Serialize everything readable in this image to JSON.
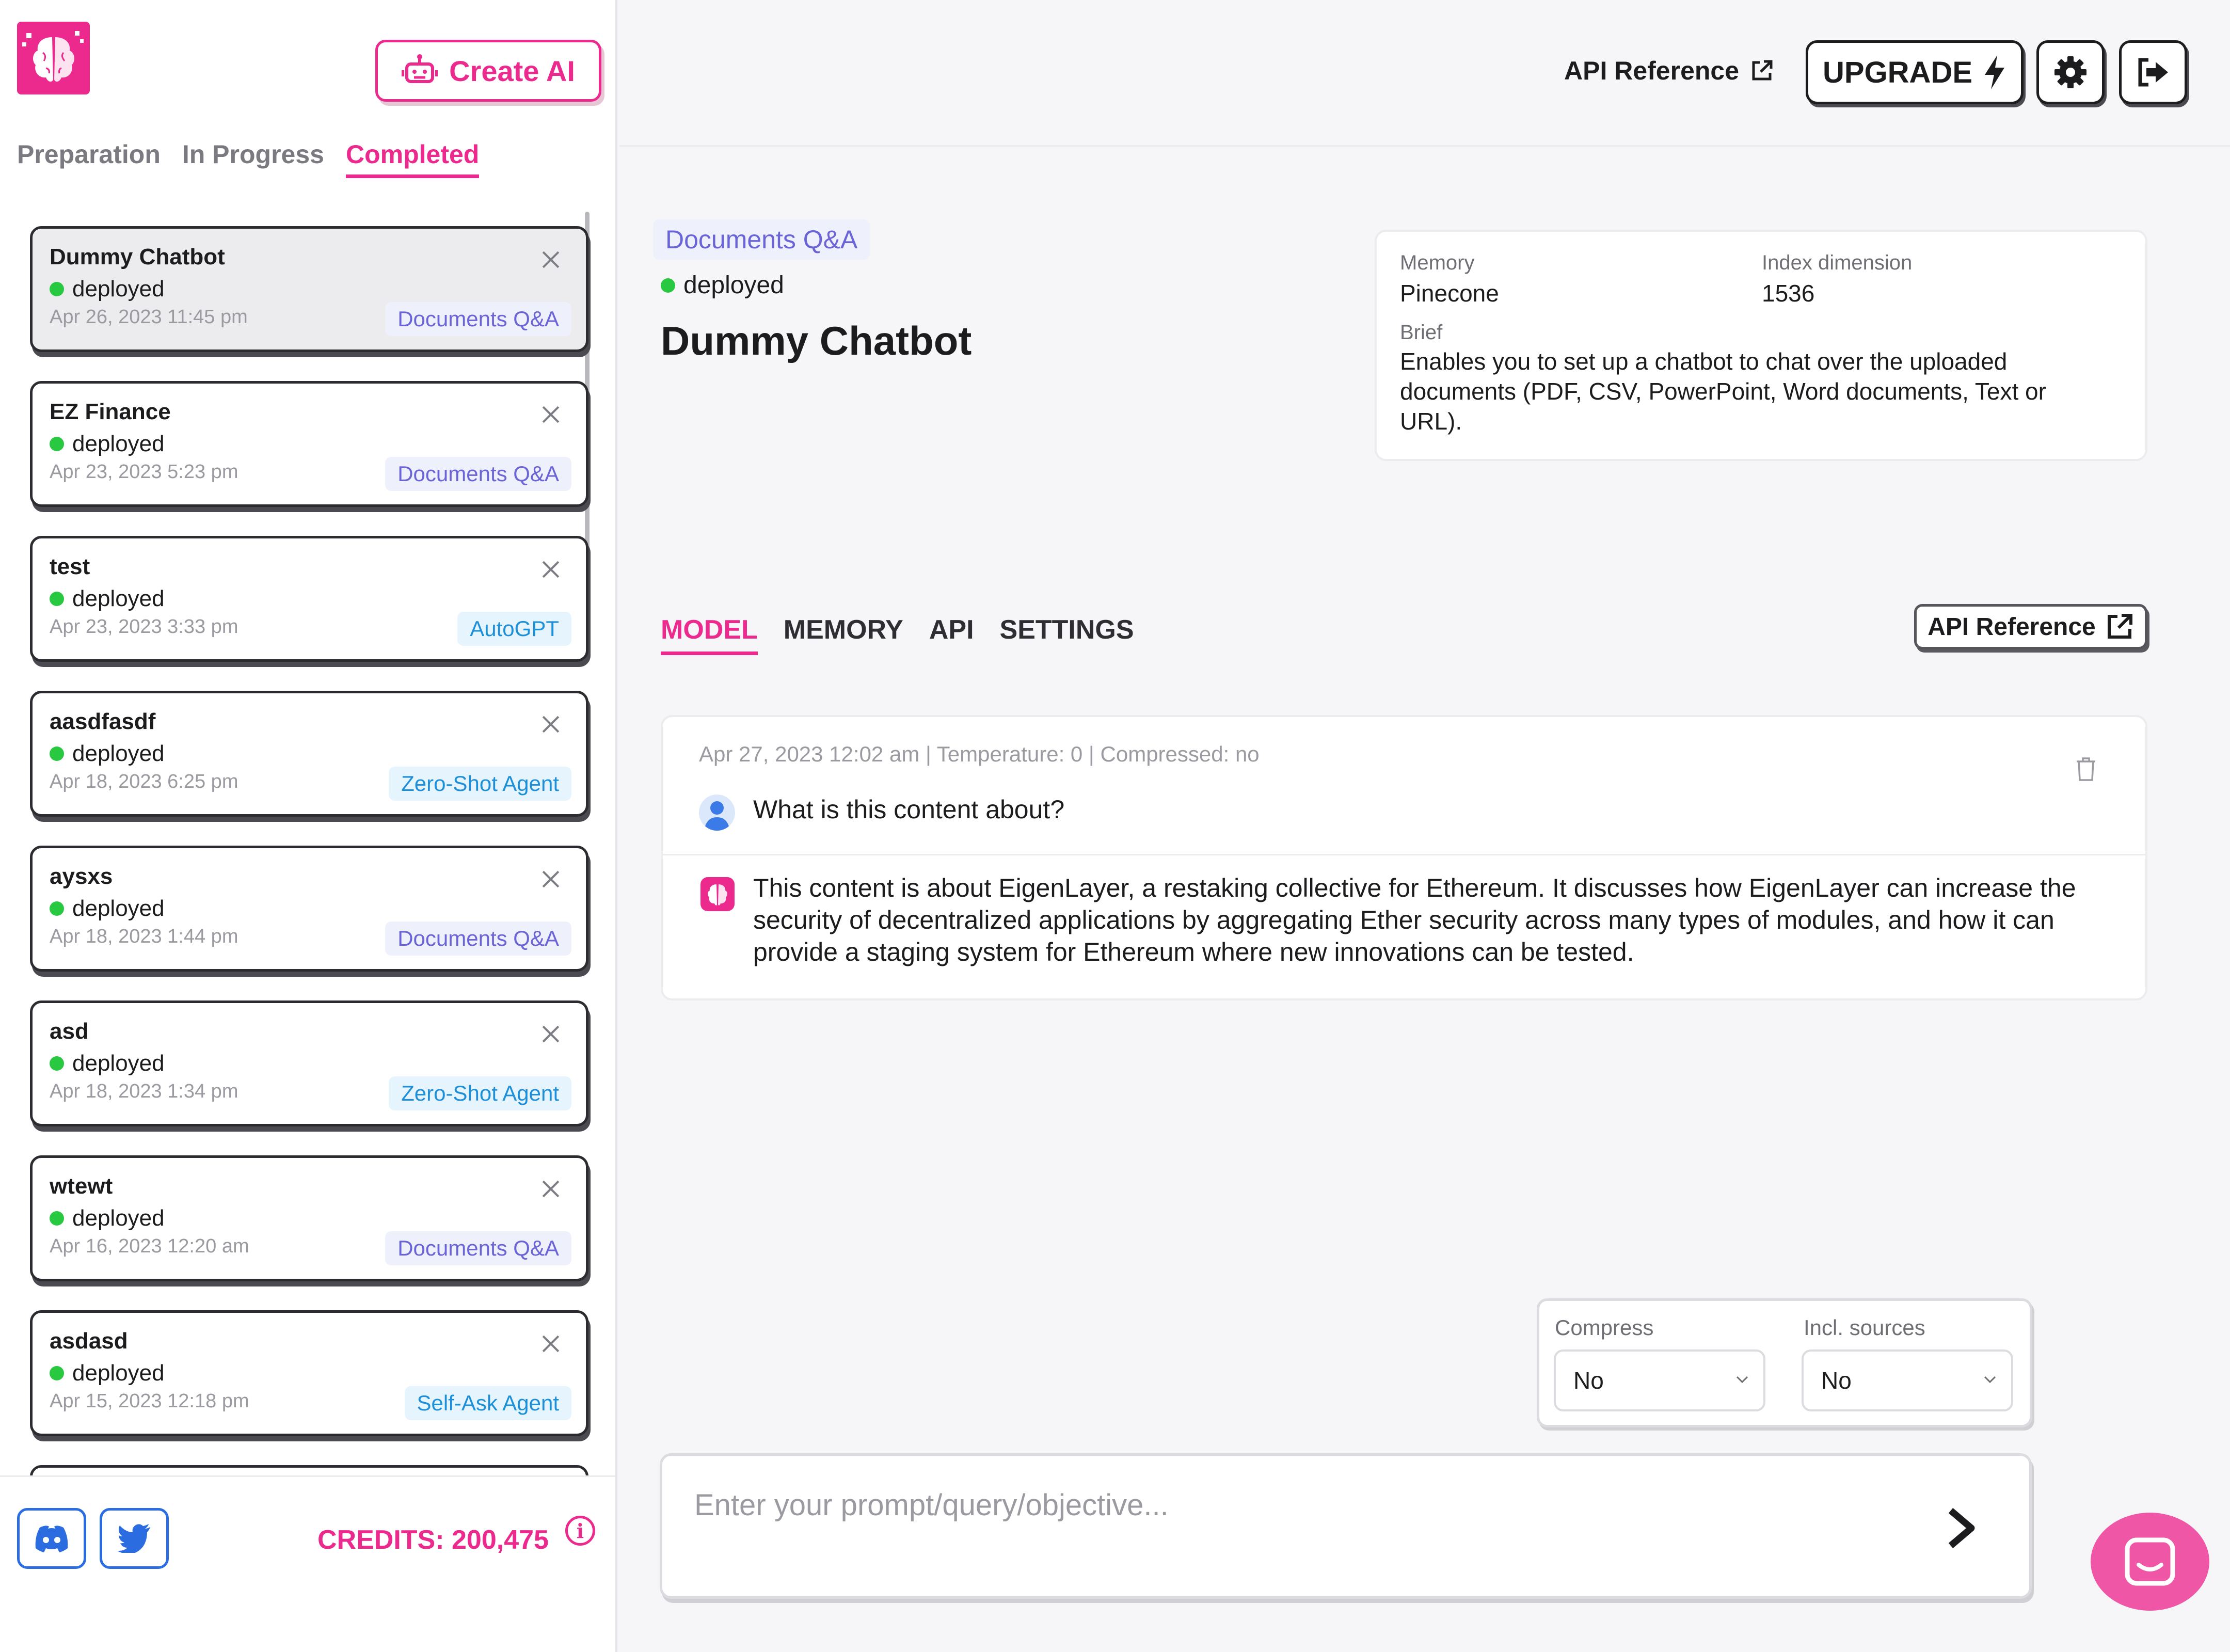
{
  "sidebar": {
    "create_button_label": "Create AI",
    "status_tabs": [
      "Preparation",
      "In Progress",
      "Completed"
    ],
    "projects": [
      {
        "name": "Dummy Chatbot",
        "status": "deployed",
        "date": "Apr 26, 2023 11:45 pm",
        "type": "Documents Q&A",
        "tag_color": "purple"
      },
      {
        "name": "EZ Finance",
        "status": "deployed",
        "date": "Apr 23, 2023 5:23 pm",
        "type": "Documents Q&A",
        "tag_color": "purple"
      },
      {
        "name": "test",
        "status": "deployed",
        "date": "Apr 23, 2023 3:33 pm",
        "type": "AutoGPT",
        "tag_color": "blue"
      },
      {
        "name": "aasdfasdf",
        "status": "deployed",
        "date": "Apr 18, 2023 6:25 pm",
        "type": "Zero-Shot Agent",
        "tag_color": "blue"
      },
      {
        "name": "aysxs",
        "status": "deployed",
        "date": "Apr 18, 2023 1:44 pm",
        "type": "Documents Q&A",
        "tag_color": "purple"
      },
      {
        "name": "asd",
        "status": "deployed",
        "date": "Apr 18, 2023 1:34 pm",
        "type": "Zero-Shot Agent",
        "tag_color": "blue"
      },
      {
        "name": "wtewt",
        "status": "deployed",
        "date": "Apr 16, 2023 12:20 am",
        "type": "Documents Q&A",
        "tag_color": "purple"
      },
      {
        "name": "asdasd",
        "status": "deployed",
        "date": "Apr 15, 2023 12:18 pm",
        "type": "Self-Ask Agent",
        "tag_color": "blue"
      }
    ],
    "credits": "CREDITS: 200,475",
    "info_icon": "i"
  },
  "topbar": {
    "api_reference": "API Reference",
    "upgrade": "UPGRADE"
  },
  "main": {
    "type_tag": "Documents Q&A",
    "status": "deployed",
    "title": "Dummy Chatbot",
    "info": {
      "memory_label": "Memory",
      "memory_value": "Pinecone",
      "index_label": "Index dimension",
      "index_value": "1536",
      "brief_label": "Brief",
      "brief_value": "Enables you to set up a chatbot to chat over the uploaded documents (PDF, CSV, PowerPoint, Word documents, Text or URL)."
    },
    "tabs": [
      "MODEL",
      "MEMORY",
      "API",
      "SETTINGS"
    ],
    "api_reference_button": "API Reference",
    "conversation": {
      "meta": "Apr 27, 2023 12:02 am | Temperature: 0 | Compressed: no",
      "question": "What is this content about?",
      "answer": "This content is about EigenLayer, a restaking collective for Ethereum. It discusses how EigenLayer can increase the security of decentralized applications by aggregating Ether security across many types of modules, and how it can provide a staging system for Ethereum where new innovations can be tested."
    },
    "options": {
      "compress_label": "Compress",
      "compress_value": "No",
      "sources_label": "Incl. sources",
      "sources_value": "No"
    },
    "prompt_placeholder": "Enter your prompt/query/objective..."
  },
  "colors": {
    "accent": "#ec2a8e",
    "status_dot": "#28c840",
    "tag_purple": "#6b64d6",
    "tag_blue": "#1d8fd9"
  }
}
